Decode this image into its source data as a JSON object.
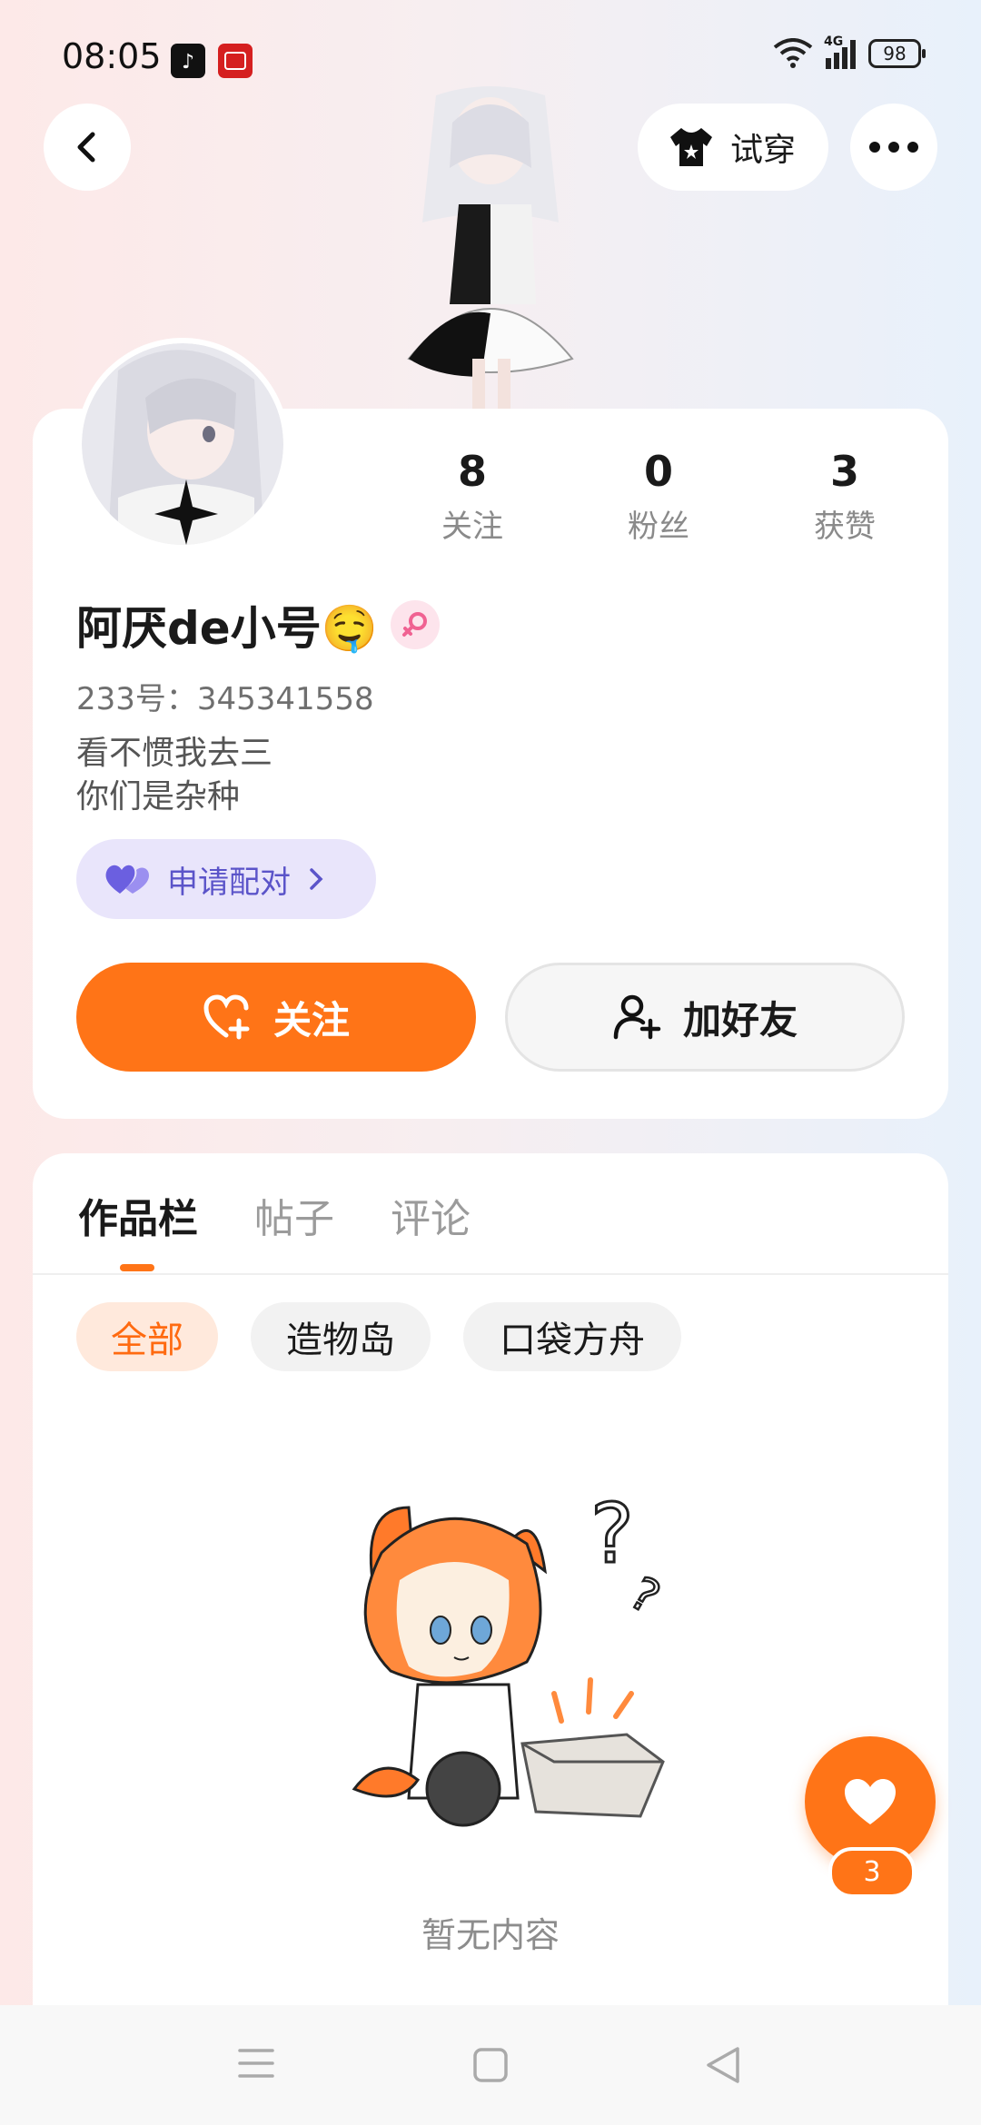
{
  "status_bar": {
    "time": "08:05",
    "battery": "98",
    "network": "4G",
    "icons": [
      "tiktok-app-icon",
      "study-app-icon",
      "wifi-icon",
      "signal-icon",
      "battery-icon"
    ]
  },
  "header": {
    "back_icon": "chevron-left-icon",
    "try_on_label": "试穿",
    "try_on_icon": "tshirt-icon",
    "more_icon": "more-dots-icon"
  },
  "profile": {
    "stats": [
      {
        "value": "8",
        "label": "关注"
      },
      {
        "value": "0",
        "label": "粉丝"
      },
      {
        "value": "3",
        "label": "获赞"
      }
    ],
    "name": "阿厌de小号🤤",
    "gender_icon": "female-icon",
    "id_line": "233号：345341558",
    "bio_line1": "看不惯我去三",
    "bio_line2": "你们是杂种",
    "pair_label": "申请配对",
    "follow_label": "关注",
    "add_friend_label": "加好友"
  },
  "content": {
    "tabs": [
      {
        "label": "作品栏",
        "active": true
      },
      {
        "label": "帖子",
        "active": false
      },
      {
        "label": "评论",
        "active": false
      }
    ],
    "filters": [
      {
        "label": "全部",
        "active": true
      },
      {
        "label": "造物岛",
        "active": false
      },
      {
        "label": "口袋方舟",
        "active": false
      }
    ],
    "empty_text": "暂无内容"
  },
  "fab": {
    "icon": "heart-icon",
    "count": "3"
  },
  "colors": {
    "accent": "#ff7417",
    "pair_bg": "#e9e5fb",
    "pair_text": "#5b54c9",
    "muted": "#8a8a8a"
  }
}
